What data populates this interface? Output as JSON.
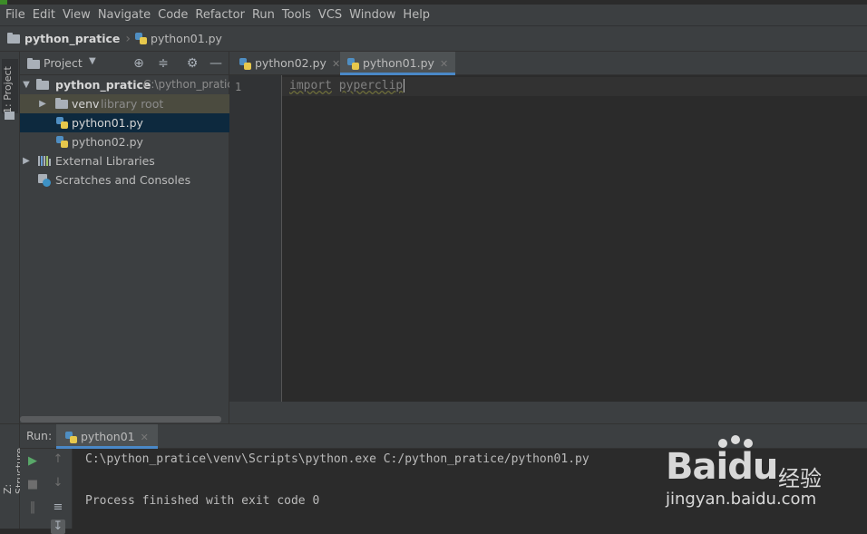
{
  "menu": [
    "File",
    "Edit",
    "View",
    "Navigate",
    "Code",
    "Refactor",
    "Run",
    "Tools",
    "VCS",
    "Window",
    "Help"
  ],
  "navbar": {
    "project": "python_pratice",
    "file": "python01.py"
  },
  "side_tabs": {
    "project": "1: Project",
    "structure": "Z: Structure"
  },
  "project_panel": {
    "title": "Project",
    "root_name": "python_pratice",
    "root_path": "C:\\python_pratic",
    "venv_name": "venv",
    "venv_note": "library root",
    "file1": "python01.py",
    "file2": "python02.py",
    "external": "External Libraries",
    "scratches": "Scratches and Consoles"
  },
  "editor": {
    "tabs": [
      "python02.py",
      "python01.py"
    ],
    "active_tab": "python01.py",
    "line_number": "1",
    "code_keyword": "import",
    "code_module": "pyperclip"
  },
  "run": {
    "label": "Run:",
    "tab": "python01",
    "line1": "C:\\python_pratice\\venv\\Scripts\\python.exe C:/python_pratice/python01.py",
    "line2": "Process finished with exit code 0"
  },
  "watermark": {
    "brand": "Baidu",
    "cn": "经验",
    "url": "jingyan.baidu.com"
  },
  "colors": {
    "accent": "#4a88c7",
    "background": "#2b2b2b",
    "panel": "#3c3f41",
    "selection": "#0d293e"
  }
}
